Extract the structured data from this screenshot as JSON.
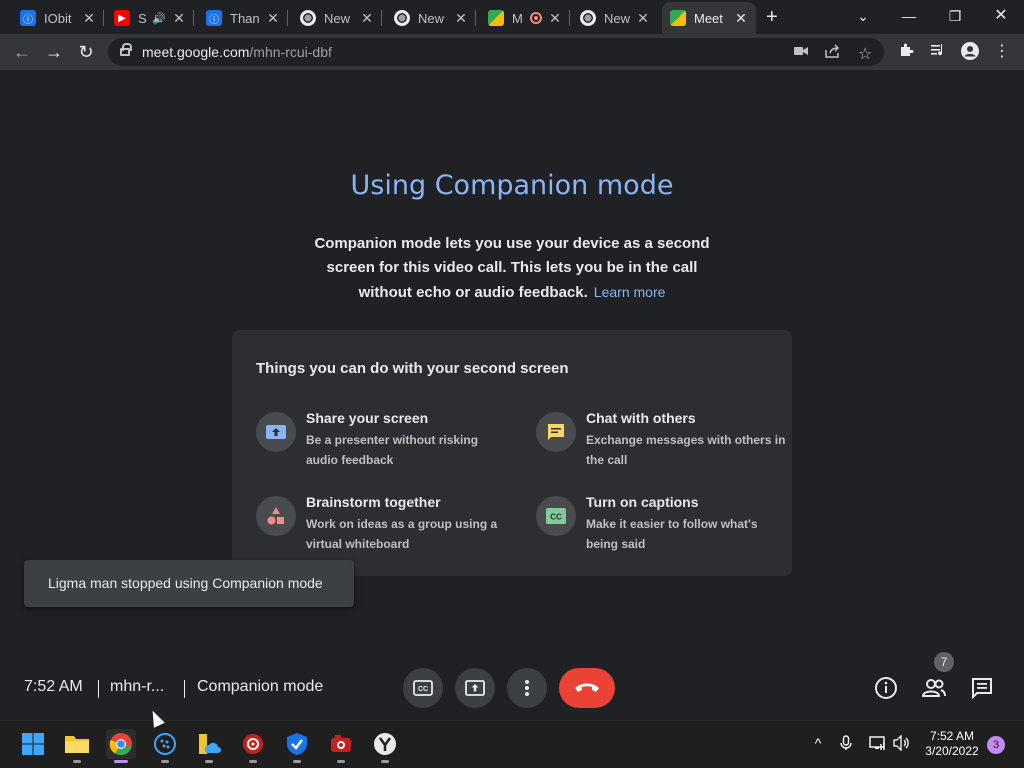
{
  "browser": {
    "tabs": [
      {
        "label": "IObit",
        "icon": "iobit-icon"
      },
      {
        "label": "S",
        "icon": "youtube-icon",
        "audio": true
      },
      {
        "label": "Thank",
        "icon": "iobit-icon"
      },
      {
        "label": "New",
        "icon": "chrome-icon"
      },
      {
        "label": "New",
        "icon": "chrome-icon"
      },
      {
        "label": "M",
        "icon": "meet-icon",
        "recording": true
      },
      {
        "label": "New",
        "icon": "chrome-icon"
      },
      {
        "label": "Meet",
        "icon": "meet-icon",
        "active": true
      }
    ],
    "url_host": "meet.google.com",
    "url_path": "/mhn-rcui-dbf"
  },
  "main": {
    "title": "Using Companion mode",
    "description": "Companion mode lets you use your device as a second screen for this video call. This lets you be in the call without echo or audio feedback.",
    "learn_more": "Learn more",
    "card_title": "Things you can do with your second screen",
    "features": [
      {
        "title": "Share your screen",
        "desc": "Be a presenter without risking audio feedback",
        "icon": "present-screen-icon",
        "color": "#8ab4f8"
      },
      {
        "title": "Chat with others",
        "desc": "Exchange messages with others in the call",
        "icon": "chat-icon",
        "color": "#fdd663"
      },
      {
        "title": "Brainstorm together",
        "desc": "Work on ideas as a group using a virtual whiteboard",
        "icon": "whiteboard-shapes-icon",
        "color": "#f28b82"
      },
      {
        "title": "Turn on captions",
        "desc": "Make it easier to follow what's being said",
        "icon": "captions-icon",
        "color": "#81c995"
      }
    ]
  },
  "toast": {
    "text": "Ligma man stopped using Companion mode"
  },
  "bottom_bar": {
    "time": "7:52 AM",
    "meeting_code": "mhn-r...",
    "mode": "Companion mode",
    "participants_count": "7"
  },
  "taskbar": {
    "clock_time": "7:52 AM",
    "clock_date": "3/20/2022",
    "notification_count": "3"
  },
  "colors": {
    "accent": "#8ab4f8",
    "end_call": "#ea4335",
    "background": "#202124"
  }
}
